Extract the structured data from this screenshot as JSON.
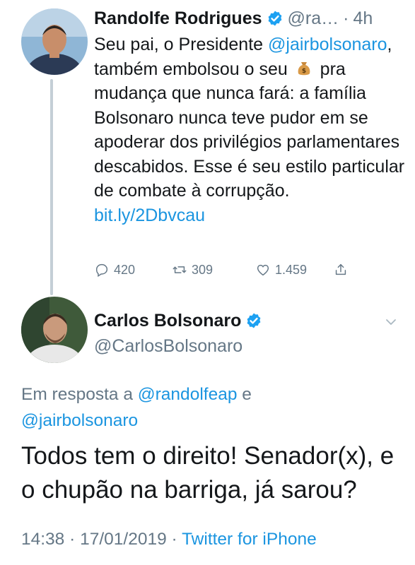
{
  "tweet1": {
    "name": "Randolfe Rodrigues",
    "handle": "@ra…",
    "time": "4h",
    "text_part1": "Seu pai, o Presidente",
    "mention": "@jairbolsonaro",
    "text_part2": ", também embolsou o seu",
    "emoji": "money-bag",
    "text_part3": "pra mudança que nunca fará: a família Bolsonaro nunca teve pudor em se apoderar dos privilégios parlamentares descabidos. Esse é seu estilo particular de combate à corrupção.",
    "link": "bit.ly/2Dbvcau",
    "replies": "420",
    "retweets": "309",
    "likes": "1.459"
  },
  "tweet2": {
    "name": "Carlos Bolsonaro",
    "handle": "@CarlosBolsonaro",
    "reply_prefix": "Em resposta a",
    "reply_user1": "@randolfeap",
    "reply_and": "e",
    "reply_user2": "@jairbolsonaro",
    "text": "Todos tem o direito! Senador(x), e o chupão na barriga, já sarou?",
    "time": "14:38",
    "date": "17/01/2019",
    "source": "Twitter for iPhone"
  },
  "colors": {
    "link": "#1b95e0",
    "secondary_text": "#657786",
    "verified": "#1da1f2",
    "thread_line": "#c4cfd6"
  }
}
